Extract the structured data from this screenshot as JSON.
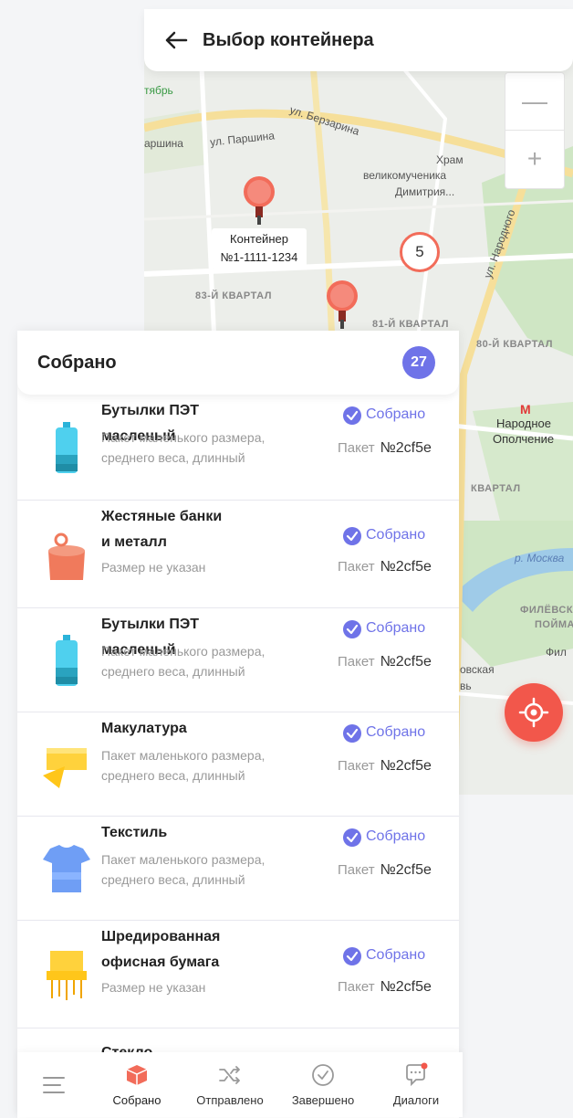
{
  "header": {
    "title": "Выбор контейнера"
  },
  "map": {
    "labels": {
      "metro_partial": "тябрь",
      "street_parshina_left": "аршина",
      "street_parshina": "ул. Паршина",
      "street_berzarina": "ул. Берзарина",
      "temple": "Храм",
      "temple_line2": "великомученика",
      "temple_line3": "Димитрия...",
      "quarter_83": "83-Й КВАРТАЛ",
      "quarter_81": "81-Й КВАРТАЛ",
      "quarter_80": "80-Й КВАРТАЛ",
      "street_narodnogo": "ул. Народного",
      "metro_station_1": "Народное",
      "metro_station_2": "Ополчение",
      "kvartal_right": "КВАРТАЛ",
      "river": "р. Москва",
      "park_1": "ФИЛЁВСК",
      "park_2": "ПОЙМА",
      "fil": "Фил",
      "ovskaya": "овская",
      "vb": "вь"
    },
    "pin_label_line1": "Контейнер",
    "pin_label_line2": "№1-1111-1234",
    "cluster_count": "5",
    "zoom_out": "—",
    "zoom_in": "+"
  },
  "panel": {
    "title": "Собрано",
    "count": "27",
    "items": [
      {
        "title_l1": "Бутылки ПЭТ масленый",
        "title_l2": "",
        "sub_l1": "Пакет маленького размера,",
        "sub_l2": "среднего веса, длинный",
        "status": "Собрано",
        "pack_label": "Пакет",
        "pack_num": "№2cf5e",
        "icon": "pet-bottle-icon"
      },
      {
        "title_l1": "Жестяные банки",
        "title_l2": "и металл",
        "sub_l1": "Размер не указан",
        "sub_l2": "",
        "status": "Собрано",
        "pack_label": "Пакет",
        "pack_num": "№2cf5e",
        "icon": "tin-can-icon"
      },
      {
        "title_l1": "Бутылки ПЭТ масленый",
        "title_l2": "",
        "sub_l1": "Пакет маленького размера,",
        "sub_l2": "среднего веса, длинный",
        "status": "Собрано",
        "pack_label": "Пакет",
        "pack_num": "№2cf5e",
        "icon": "pet-bottle-icon"
      },
      {
        "title_l1": "Макулатура",
        "title_l2": "",
        "sub_l1": "Пакет маленького размера,",
        "sub_l2": "среднего веса, длинный",
        "status": "Собрано",
        "pack_label": "Пакет",
        "pack_num": "№2cf5e",
        "icon": "paper-stack-icon"
      },
      {
        "title_l1": "Текстиль",
        "title_l2": "",
        "sub_l1": "Пакет маленького размера,",
        "sub_l2": "среднего веса, длинный",
        "status": "Собрано",
        "pack_label": "Пакет",
        "pack_num": "№2cf5e",
        "icon": "tshirt-icon"
      },
      {
        "title_l1": "Шредированная",
        "title_l2": "офисная бумага",
        "sub_l1": "Размер не указан",
        "sub_l2": "",
        "status": "Собрано",
        "pack_label": "Пакет",
        "pack_num": "№2cf5e",
        "icon": "shredded-paper-icon"
      }
    ],
    "partial_item_title": "Стекло"
  },
  "tabbar": {
    "tabs": [
      {
        "label": "Собрано"
      },
      {
        "label": "Отправлено"
      },
      {
        "label": "Завершено"
      },
      {
        "label": "Диалоги"
      }
    ]
  },
  "colors": {
    "accent": "#6f73e8",
    "danger": "#f2574b",
    "active_tab": "#f26c5a"
  }
}
